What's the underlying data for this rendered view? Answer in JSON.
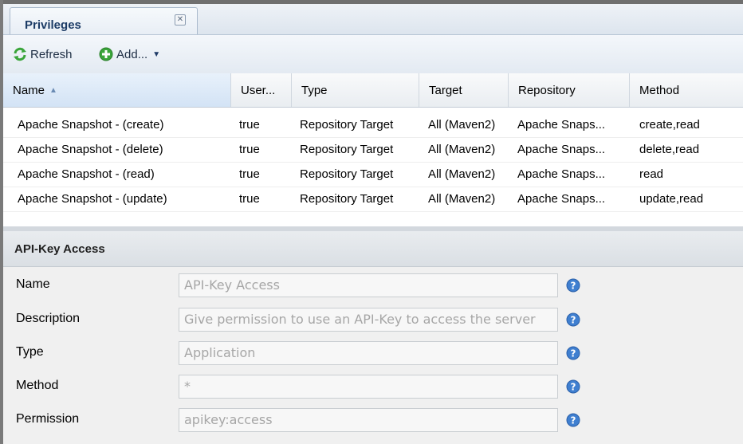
{
  "tab": {
    "label": "Privileges",
    "close_glyph": "✕"
  },
  "toolbar": {
    "refresh_label": "Refresh",
    "add_label": "Add...",
    "refresh_icon": "refresh-icon",
    "add_icon": "add-icon"
  },
  "grid": {
    "columns": [
      "Name",
      "User...",
      "Type",
      "Target",
      "Repository",
      "Method"
    ],
    "sorted_column": "Name",
    "rows": [
      {
        "name": "Apache Snapshot - (create)",
        "user": "true",
        "type": "Repository Target",
        "target": "All (Maven2)",
        "repository": "Apache Snaps...",
        "method": "create,read"
      },
      {
        "name": "Apache Snapshot - (delete)",
        "user": "true",
        "type": "Repository Target",
        "target": "All (Maven2)",
        "repository": "Apache Snaps...",
        "method": "delete,read"
      },
      {
        "name": "Apache Snapshot - (read)",
        "user": "true",
        "type": "Repository Target",
        "target": "All (Maven2)",
        "repository": "Apache Snaps...",
        "method": "read"
      },
      {
        "name": "Apache Snapshot - (update)",
        "user": "true",
        "type": "Repository Target",
        "target": "All (Maven2)",
        "repository": "Apache Snaps...",
        "method": "update,read"
      }
    ]
  },
  "form": {
    "title": "API-Key Access",
    "fields": [
      {
        "label": "Name",
        "value": "API-Key Access"
      },
      {
        "label": "Description",
        "value": "Give permission to use an API-Key to access the server"
      },
      {
        "label": "Type",
        "value": "Application"
      },
      {
        "label": "Method",
        "value": "*"
      },
      {
        "label": "Permission",
        "value": "apikey:access"
      }
    ]
  },
  "colors": {
    "accent": "#1c3c66",
    "help_icon": "#3f7fd0",
    "add_icon": "#3aa53a"
  }
}
